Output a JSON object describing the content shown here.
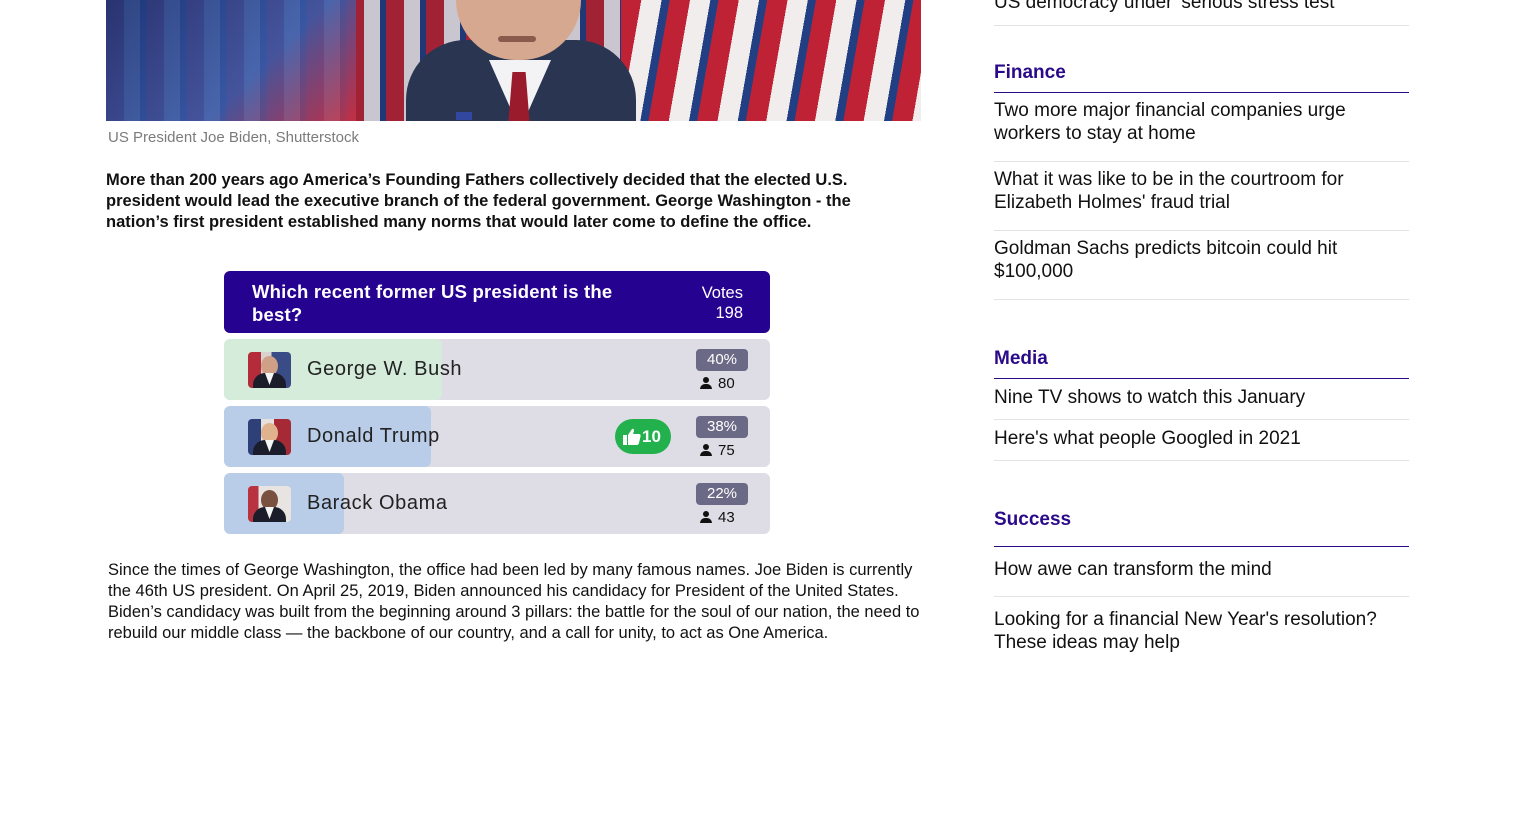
{
  "article": {
    "caption": "US President Joe Biden, Shutterstock",
    "lead": "More than 200 years ago America’s Founding Fathers collectively decided that the elected U.S. president would lead the executive branch of the federal government. George Washington - the nation’s first president established many norms that would later come to define the office.",
    "body": "Since the times of George Washington, the office had been led by many famous names. Joe Biden is currently the 46th US president. On April 25, 2019, Biden announced his candidacy for President of the United States. Biden’s candidacy was built from the beginning around 3 pillars: the battle for the soul of our nation, the need to rebuild our middle class — the backbone of our country, and a call for unity, to act as One America."
  },
  "poll": {
    "question": "Which recent former US president is the best?",
    "votes_label": "Votes",
    "votes_total": "198",
    "options": [
      {
        "name": "George W. Bush",
        "percent_label": "40%",
        "count": "80",
        "share": 0.4,
        "fill_color": "#d4ecd9",
        "avatar_icon": "bush-portrait-icon"
      },
      {
        "name": "Donald Trump",
        "percent_label": "38%",
        "count": "75",
        "share": 0.38,
        "fill_color": "#b9cde8",
        "avatar_icon": "trump-portrait-icon",
        "likes": "10"
      },
      {
        "name": "Barack Obama",
        "percent_label": "22%",
        "count": "43",
        "share": 0.22,
        "fill_color": "#b9cde8",
        "avatar_icon": "obama-portrait-icon"
      }
    ],
    "colors": {
      "header": "#260291",
      "like": "#23b14d",
      "percent_badge": "#6a6a86"
    }
  },
  "sidebar": {
    "top_item": "US democracy under 'serious stress test'",
    "categories": [
      {
        "title": "Finance",
        "items": [
          "Two more major financial companies urge workers to stay at home",
          "What it was like to be in the courtroom for Elizabeth Holmes' fraud trial",
          "Goldman Sachs predicts bitcoin could hit $100,000"
        ]
      },
      {
        "title": "Media",
        "items": [
          "Nine TV shows to watch this January",
          "Here's what people Googled in 2021"
        ]
      },
      {
        "title": "Success",
        "items": [
          "How awe can transform the mind",
          "Looking for a financial New Year's resolution? These ideas may help"
        ]
      }
    ],
    "accent": "#2b0a8a"
  }
}
